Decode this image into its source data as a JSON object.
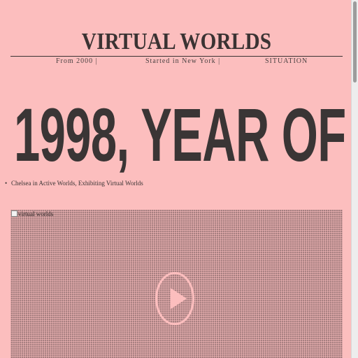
{
  "site": {
    "title": "VIRTUAL WORLDS"
  },
  "nav": {
    "items": [
      {
        "label": "From 2000  |"
      },
      {
        "label": "Started in New York  |"
      },
      {
        "label": "SITUATION"
      }
    ]
  },
  "headline": "1998, YEAR OF",
  "bullets": [
    "Chelsea in Active Worlds, Exhibiting Virtual Worlds"
  ],
  "video": {
    "alt": "virtual worlds",
    "play_icon": "play-icon"
  },
  "colors": {
    "background": "#fcbebe",
    "text": "#3a3434",
    "video_fill": "#a77f80"
  }
}
